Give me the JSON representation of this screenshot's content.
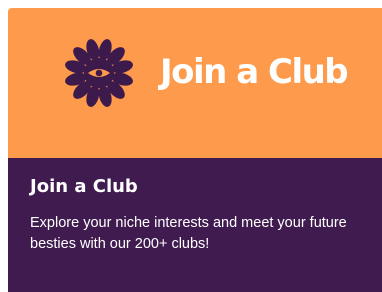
{
  "card": {
    "banner_logo_text": "Join a Club",
    "title": "Join a Club",
    "description": "Explore your niche interests and meet your future besties with our 200+ clubs!",
    "logo_icon": "flower-eye-icon"
  },
  "colors": {
    "banner_background": "#fd9a4b",
    "panel_background": "#401b4f",
    "icon_color": "#3d1a4c",
    "text": "#ffffff"
  }
}
